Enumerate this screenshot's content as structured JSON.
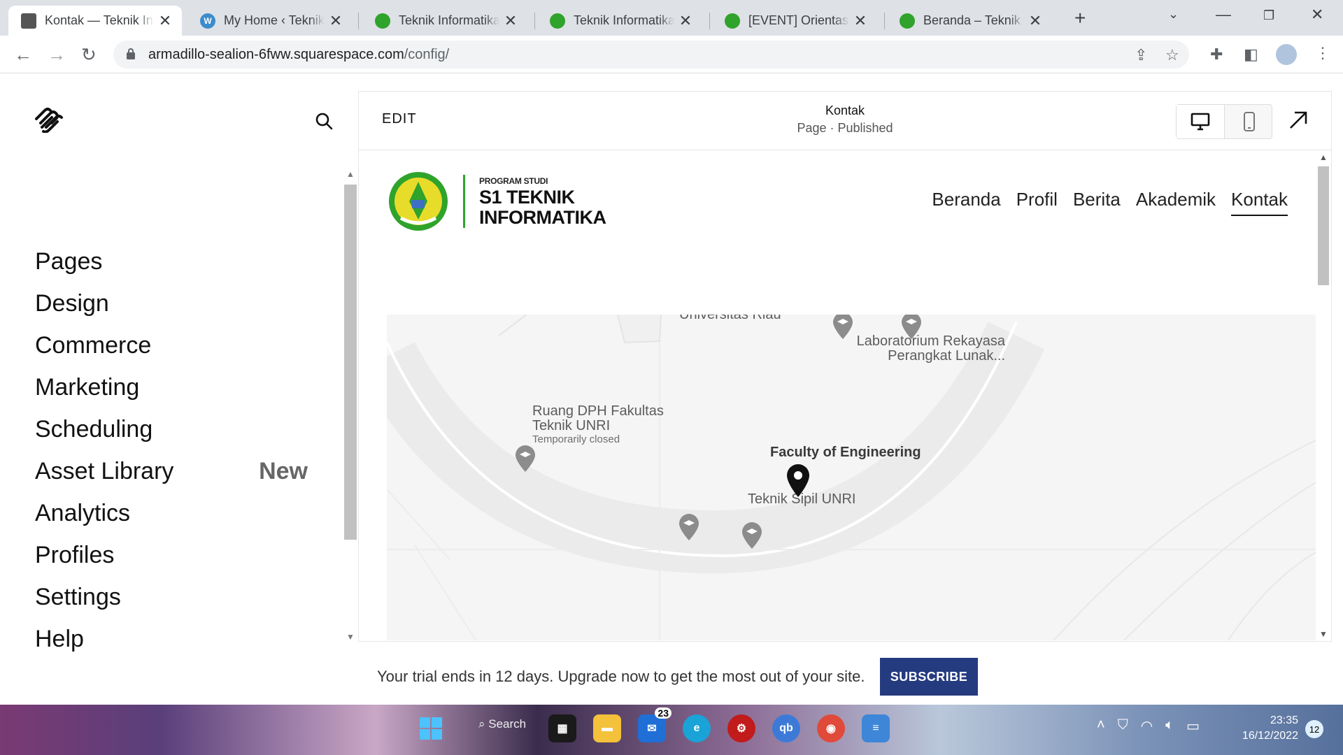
{
  "browser": {
    "tabs": [
      {
        "title": "Kontak — Teknik Informatika",
        "active": true,
        "favicon": "squarespace-cube-icon"
      },
      {
        "title": "My Home ‹ Teknik Informatika",
        "active": false,
        "favicon": "wordpress-icon"
      },
      {
        "title": "Teknik Informatika UNRI",
        "active": false,
        "favicon": "unri-logo-icon"
      },
      {
        "title": "Teknik Informatika UNRI",
        "active": false,
        "favicon": "unri-logo-icon"
      },
      {
        "title": "[EVENT] Orientasi Program Studi",
        "active": false,
        "favicon": "unri-logo-icon"
      },
      {
        "title": "Beranda – Teknik Informatika",
        "active": false,
        "favicon": "unri-logo-icon"
      }
    ],
    "url_host": "armadillo-sealion-6fww.squarespace.com",
    "url_path": "/config/"
  },
  "sidebar": {
    "menu": [
      {
        "label": "Pages",
        "badge": ""
      },
      {
        "label": "Design",
        "badge": ""
      },
      {
        "label": "Commerce",
        "badge": ""
      },
      {
        "label": "Marketing",
        "badge": ""
      },
      {
        "label": "Scheduling",
        "badge": ""
      },
      {
        "label": "Asset Library",
        "badge": "New"
      },
      {
        "label": "Analytics",
        "badge": ""
      },
      {
        "label": "Profiles",
        "badge": ""
      },
      {
        "label": "Settings",
        "badge": ""
      },
      {
        "label": "Help",
        "badge": ""
      }
    ]
  },
  "editor": {
    "edit_label": "EDIT",
    "page_title": "Kontak",
    "page_status": "Page · Published"
  },
  "site": {
    "brand_small": "PROGRAM STUDI",
    "brand_line1": "S1 TEKNIK",
    "brand_line2": "INFORMATIKA",
    "nav": [
      "Beranda",
      "Profil",
      "Berita",
      "Akademik",
      "Kontak"
    ],
    "nav_current": "Kontak",
    "map": {
      "labels": {
        "top_partial": "Universitas Riau",
        "lab_line1": "Laboratorium Rekayasa",
        "lab_line2": "Perangkat Lunak...",
        "dph_line1": "Ruang DPH Fakultas",
        "dph_line2": "Teknik UNRI",
        "dph_status": "Temporarily closed",
        "faculty": "Faculty of Engineering",
        "sipil": "Teknik Sipil UNRI"
      }
    }
  },
  "trial": {
    "message": "Your trial ends in 12 days. Upgrade now to get the most out of your site.",
    "button": "SUBSCRIBE"
  },
  "taskbar": {
    "search": "Search",
    "mail_count": "23",
    "time": "23:35",
    "date": "16/12/2022",
    "notifications": "12"
  }
}
